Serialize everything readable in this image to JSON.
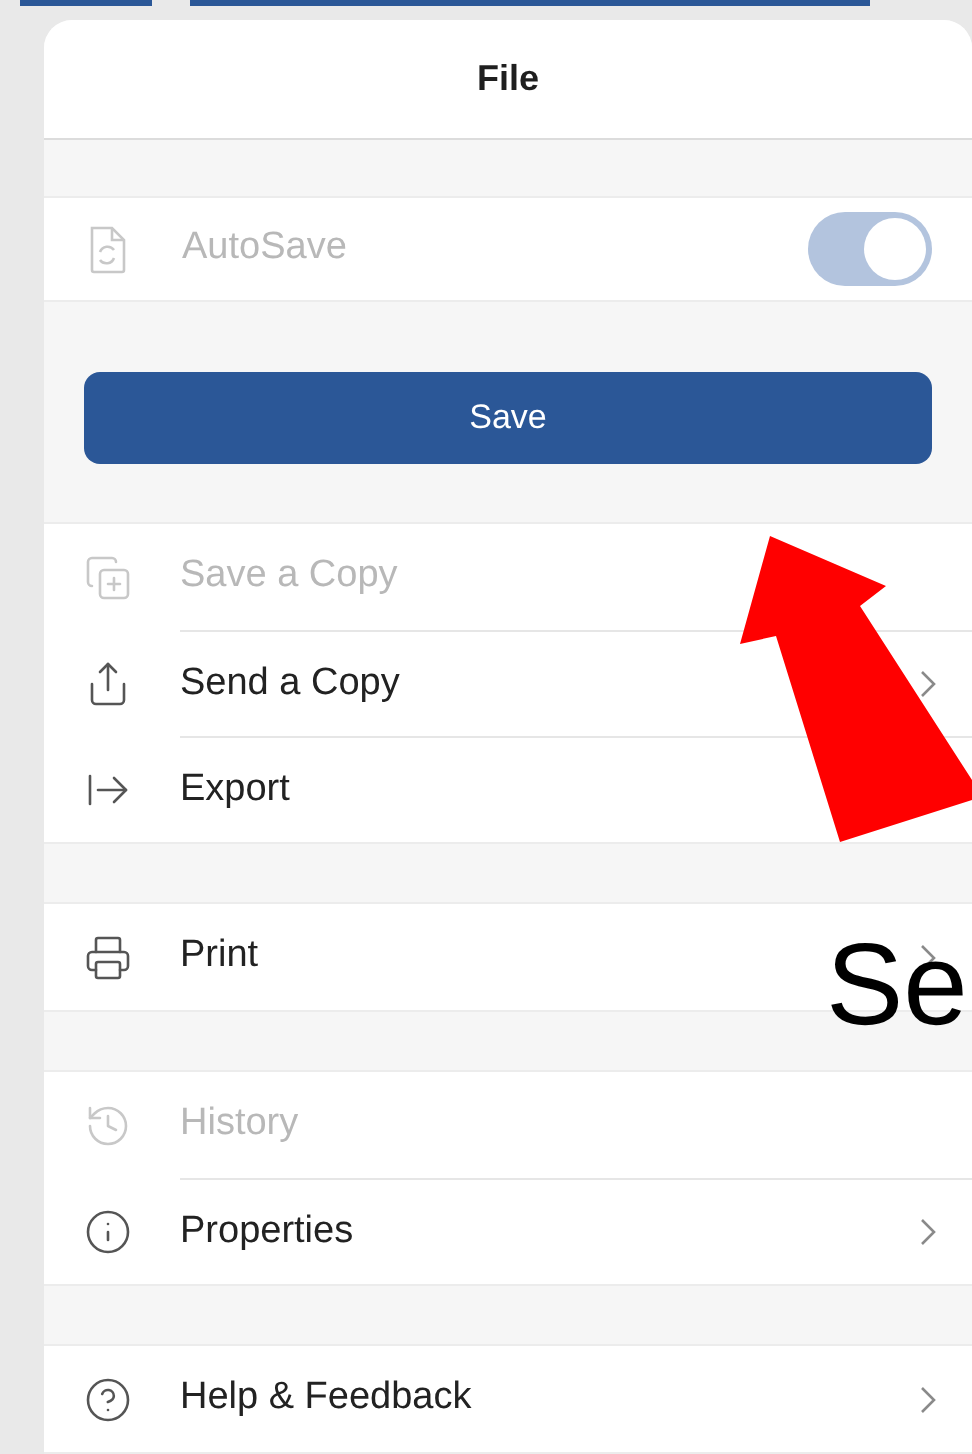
{
  "panel": {
    "title": "File"
  },
  "autosave": {
    "label": "AutoSave",
    "on": true,
    "disabled": true
  },
  "save_button": {
    "label": "Save"
  },
  "groups": [
    [
      {
        "kind": "save-copy",
        "label": "Save a Copy",
        "disabled": true,
        "chevron": false
      },
      {
        "kind": "share",
        "label": "Send a Copy",
        "disabled": false,
        "chevron": true
      },
      {
        "kind": "export",
        "label": "Export",
        "disabled": false,
        "chevron": false
      }
    ],
    [
      {
        "kind": "print",
        "label": "Print",
        "disabled": false,
        "chevron": true
      }
    ],
    [
      {
        "kind": "history",
        "label": "History",
        "disabled": true,
        "chevron": false
      },
      {
        "kind": "info",
        "label": "Properties",
        "disabled": false,
        "chevron": true
      }
    ],
    [
      {
        "kind": "help",
        "label": "Help & Feedback",
        "disabled": false,
        "chevron": true
      }
    ]
  ],
  "overlay": {
    "text": "Se"
  }
}
